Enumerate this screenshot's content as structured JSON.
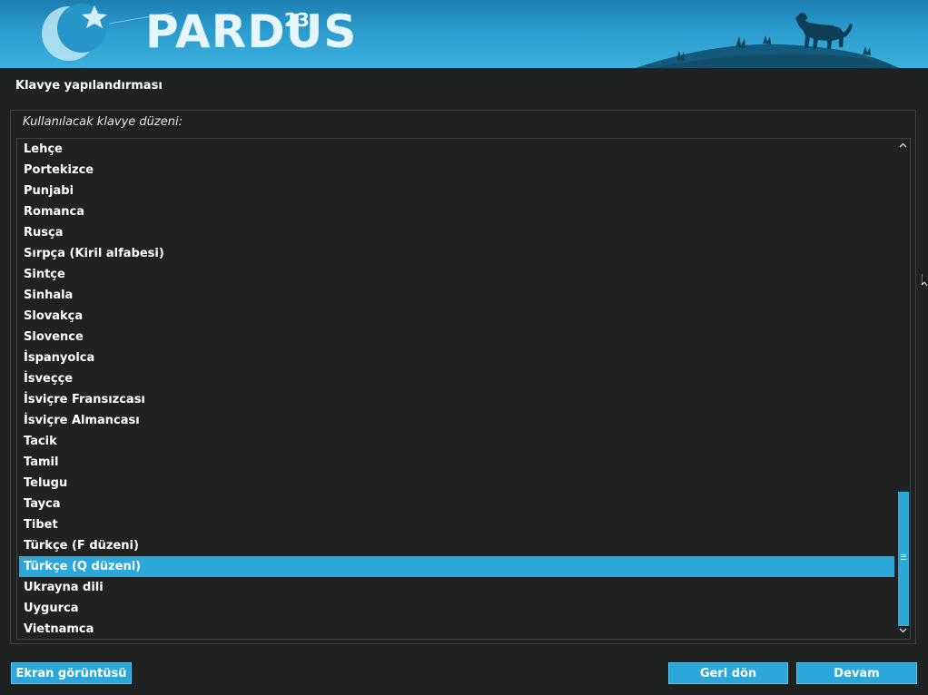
{
  "banner": {
    "logo_text": "PARDUS",
    "logo_version": "23"
  },
  "page_title": "Klavye yapılandırması",
  "prompt_label": "Kullanılacak klavye düzeni:",
  "keyboard_layouts": [
    "Lehçe",
    "Portekizce",
    "Punjabi",
    "Romanca",
    "Rusça",
    "Sırpça (Kiril alfabesi)",
    "Sintçe",
    "Sinhala",
    "Slovakça",
    "Slovence",
    "İspanyolca",
    "İsveççe",
    "İsviçre Fransızcası",
    "İsviçre Almancası",
    "Tacik",
    "Tamil",
    "Telugu",
    "Tayca",
    "Tibet",
    "Türkçe (F düzeni)",
    "Türkçe (Q düzeni)",
    "Ukrayna dili",
    "Uygurca",
    "Vietnamca"
  ],
  "selected_layout": "Türkçe (Q düzeni)",
  "buttons": {
    "screenshot": "Ekran görüntüsü",
    "back": "Geri dön",
    "continue": "Devam"
  },
  "colors": {
    "accent": "#2ba7d9",
    "background": "#1f2220",
    "banner_top": "#1c7fb0",
    "banner_bottom": "#3bb0dc"
  },
  "icons": {
    "scroll_up": "chevron-up-icon",
    "scroll_down": "chevron-down-icon",
    "banner_moon": "crescent-moon-icon",
    "banner_star": "star-icon",
    "banner_animal": "leopard-silhouette-icon"
  }
}
